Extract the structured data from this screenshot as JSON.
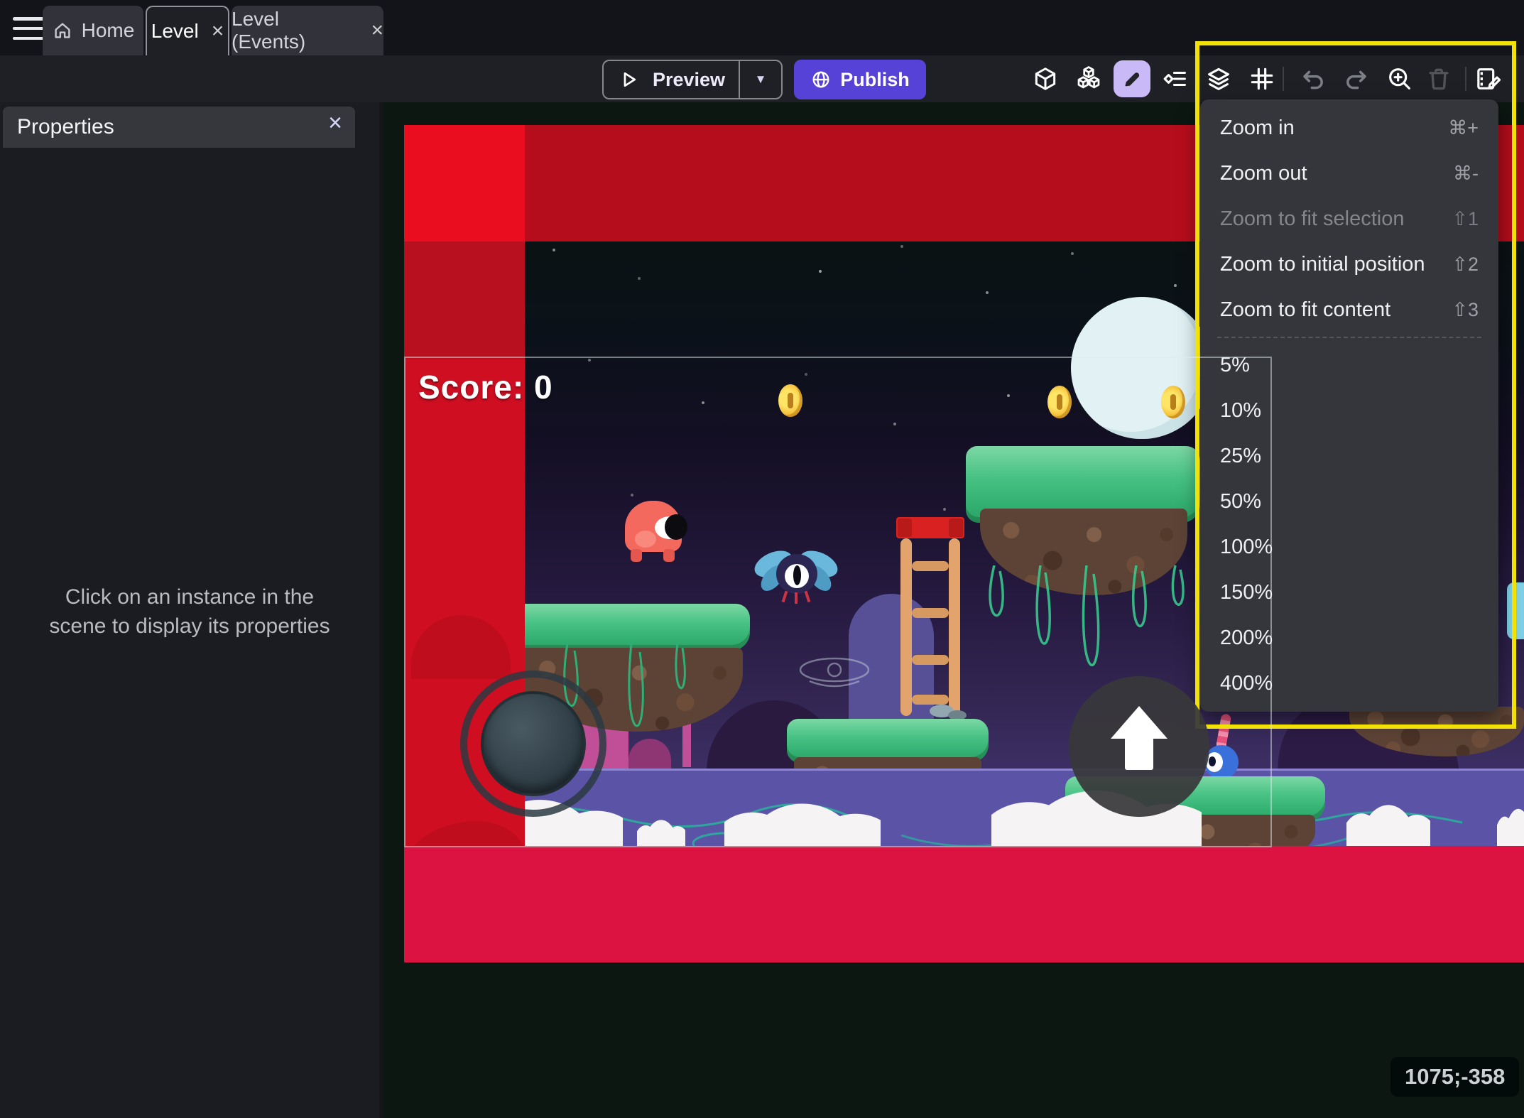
{
  "tabs": {
    "home": "Home",
    "level": "Level",
    "level_events": "Level (Events)"
  },
  "toolbar": {
    "preview_label": "Preview",
    "publish_label": "Publish"
  },
  "icons": {
    "close": "×",
    "caret_down": "▼"
  },
  "properties_panel": {
    "title": "Properties",
    "empty_message": "Click on an instance in the scene to display its properties"
  },
  "scene": {
    "score_text": "Score: 0",
    "cursor_coordinates": "1075;-358"
  },
  "zoom_menu": {
    "items": [
      {
        "label": "Zoom in",
        "shortcut": "⌘+",
        "disabled": false
      },
      {
        "label": "Zoom out",
        "shortcut": "⌘-",
        "disabled": false
      },
      {
        "label": "Zoom to fit selection",
        "shortcut": "⇧1",
        "disabled": true
      },
      {
        "label": "Zoom to initial position",
        "shortcut": "⇧2",
        "disabled": false
      },
      {
        "label": "Zoom to fit content",
        "shortcut": "⇧3",
        "disabled": false
      },
      {
        "label": "5%",
        "shortcut": "",
        "disabled": false
      },
      {
        "label": "10%",
        "shortcut": "",
        "disabled": false
      },
      {
        "label": "25%",
        "shortcut": "",
        "disabled": false
      },
      {
        "label": "50%",
        "shortcut": "",
        "disabled": false
      },
      {
        "label": "100%",
        "shortcut": "",
        "disabled": false
      },
      {
        "label": "150%",
        "shortcut": "",
        "disabled": false
      },
      {
        "label": "200%",
        "shortcut": "",
        "disabled": false
      },
      {
        "label": "400%",
        "shortcut": "",
        "disabled": false
      }
    ]
  },
  "colors": {
    "accent_purple": "#5742d8",
    "selected_tool_bg": "#c9b9f6",
    "highlight_yellow": "#f2e106",
    "scene_red_band": "#cf0e22",
    "scene_top_bar": "#b60d1c",
    "scene_bottom_bar": "#dc1340"
  }
}
